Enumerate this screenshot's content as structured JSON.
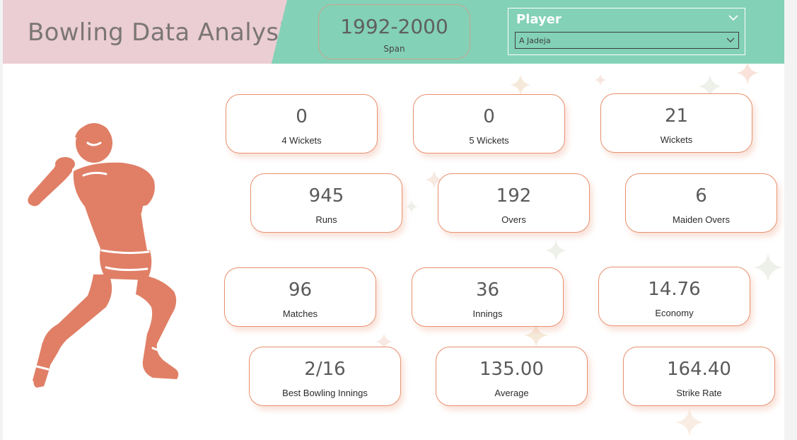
{
  "dashboard": {
    "title": "Bowling Data Analysis",
    "span": {
      "value": "1992-2000",
      "label": "Span"
    },
    "player_filter": {
      "title": "Player",
      "selected": "A Jadeja"
    }
  },
  "colors": {
    "header_green": "#83d1b7",
    "title_pink": "#ebcdd4",
    "card_border": "#e8906f",
    "bowler_fill": "#e07f66",
    "sparkle": "#f3e6d8"
  },
  "icons": {
    "slicer_dropdown": "chevron-down-icon",
    "bowler_illustration": "cricket-bowler-icon",
    "background_decor": "sparkle-icon"
  },
  "kpis": {
    "four_wickets": {
      "value": "0",
      "label": "4 Wickets"
    },
    "five_wickets": {
      "value": "0",
      "label": "5 Wickets"
    },
    "wickets": {
      "value": "21",
      "label": "Wickets"
    },
    "runs": {
      "value": "945",
      "label": "Runs"
    },
    "overs": {
      "value": "192",
      "label": "Overs"
    },
    "maiden_overs": {
      "value": "6",
      "label": "Maiden Overs"
    },
    "matches": {
      "value": "96",
      "label": "Matches"
    },
    "innings": {
      "value": "36",
      "label": "Innings"
    },
    "economy": {
      "value": "14.76",
      "label": "Economy"
    },
    "best_bowling_innings": {
      "value": "2/16",
      "label": "Best Bowling Innings"
    },
    "average": {
      "value": "135.00",
      "label": "Average"
    },
    "strike_rate": {
      "value": "164.40",
      "label": "Strike Rate"
    }
  }
}
